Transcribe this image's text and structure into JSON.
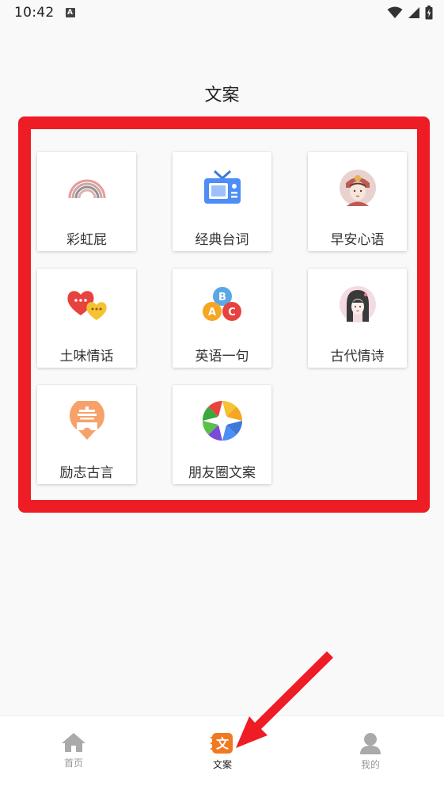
{
  "status_bar": {
    "time": "10:42",
    "notification_letter": "A",
    "icons": [
      "wifi-icon",
      "signal-icon",
      "battery-icon"
    ]
  },
  "page": {
    "title": "文案"
  },
  "categories": [
    {
      "label": "彩虹屁",
      "icon": "rainbow-icon"
    },
    {
      "label": "经典台词",
      "icon": "tv-icon"
    },
    {
      "label": "早安心语",
      "icon": "girl-avatar-icon"
    },
    {
      "label": "土味情话",
      "icon": "hearts-chat-icon"
    },
    {
      "label": "英语一句",
      "icon": "abc-balls-icon"
    },
    {
      "label": "古代情诗",
      "icon": "ancient-lady-icon"
    },
    {
      "label": "励志古言",
      "icon": "pavilion-icon"
    },
    {
      "label": "朋友圈文案",
      "icon": "aperture-icon"
    }
  ],
  "bottom_nav": {
    "items": [
      {
        "label": "首页",
        "icon": "home-icon",
        "active": false
      },
      {
        "label": "文案",
        "icon": "wen-icon",
        "glyph": "文",
        "active": true
      },
      {
        "label": "我的",
        "icon": "person-icon",
        "active": false
      }
    ]
  },
  "colors": {
    "highlight": "#ee1c25",
    "accent": "#f07a22",
    "nav_inactive": "#999999"
  }
}
